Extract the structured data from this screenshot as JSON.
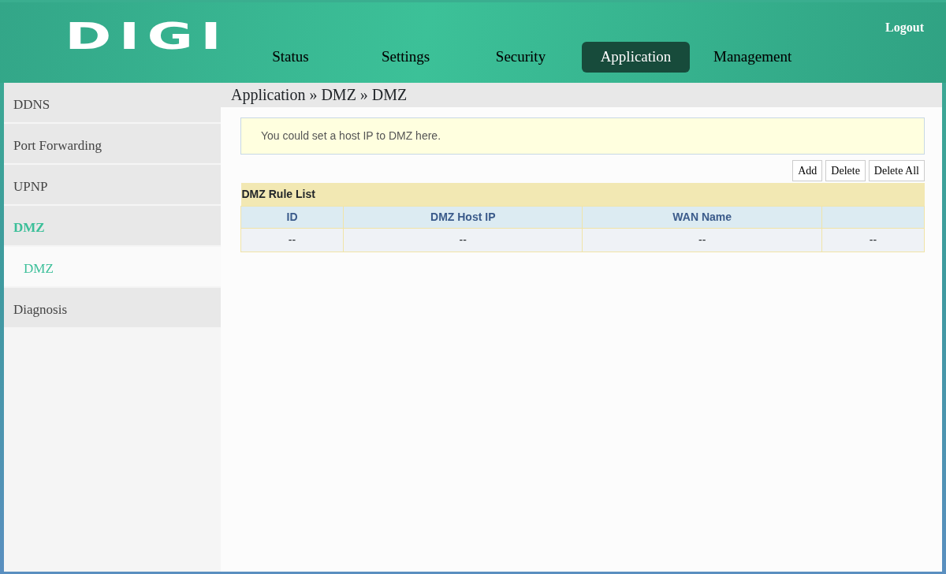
{
  "header": {
    "logo": "DIGI",
    "logout": "Logout",
    "tabs": [
      {
        "label": "Status",
        "selected": false
      },
      {
        "label": "Settings",
        "selected": false
      },
      {
        "label": "Security",
        "selected": false
      },
      {
        "label": "Application",
        "selected": true
      },
      {
        "label": "Management",
        "selected": false
      }
    ]
  },
  "sidebar": {
    "items": [
      {
        "label": "DDNS",
        "selected": false
      },
      {
        "label": "Port Forwarding",
        "selected": false
      },
      {
        "label": "UPNP",
        "selected": false
      },
      {
        "label": "DMZ",
        "selected": true,
        "children": [
          {
            "label": "DMZ",
            "selected": true
          }
        ]
      },
      {
        "label": "Diagnosis",
        "selected": false
      }
    ]
  },
  "breadcrumb": "Application » DMZ » DMZ",
  "info": "You could set a host IP to DMZ here.",
  "buttons": [
    "Add",
    "Delete",
    "Delete All"
  ],
  "table": {
    "title": "DMZ Rule List",
    "columns": [
      "ID",
      "DMZ Host IP",
      "WAN Name",
      ""
    ],
    "rows": [
      [
        "--",
        "--",
        "--",
        "--"
      ]
    ]
  }
}
